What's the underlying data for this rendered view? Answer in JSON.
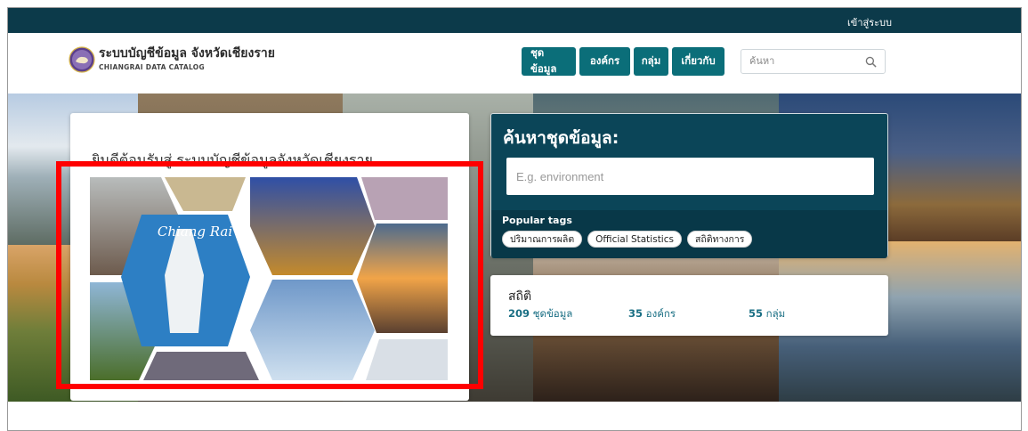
{
  "topbar": {
    "login": "เข้าสู่ระบบ"
  },
  "header": {
    "site_title": "ระบบบัญชีข้อมูล จังหวัดเชียงราย",
    "site_subtitle": "CHIANGRAI DATA CATALOG",
    "nav": [
      "ชุดข้อมูล",
      "องค์กร",
      "กลุ่ม",
      "เกี่ยวกับ"
    ],
    "search_placeholder": "ค้นหา"
  },
  "hero": {
    "welcome": "ยินดีต้อนรับสู่ ระบบบัญชีข้อมูลจังหวัดเชียงราย",
    "collage_caption": "Chiang Rai",
    "search_title": "ค้นหาชุดข้อมูล:",
    "search_placeholder": "E.g. environment",
    "popular_tags_label": "Popular tags",
    "tags": [
      "ปริมาณการผลิต",
      "Official Statistics",
      "สถิติทางการ"
    ],
    "stats_title": "สถิติ",
    "stats": [
      {
        "count": "209",
        "label": "ชุดข้อมูล"
      },
      {
        "count": "35",
        "label": "องค์กร"
      },
      {
        "count": "55",
        "label": "กลุ่ม"
      }
    ]
  },
  "colors": {
    "topbar": "#0c3a4a",
    "nav_button": "#0b6e79",
    "search_panel": "#0b4558",
    "highlight": "#ff0000"
  }
}
